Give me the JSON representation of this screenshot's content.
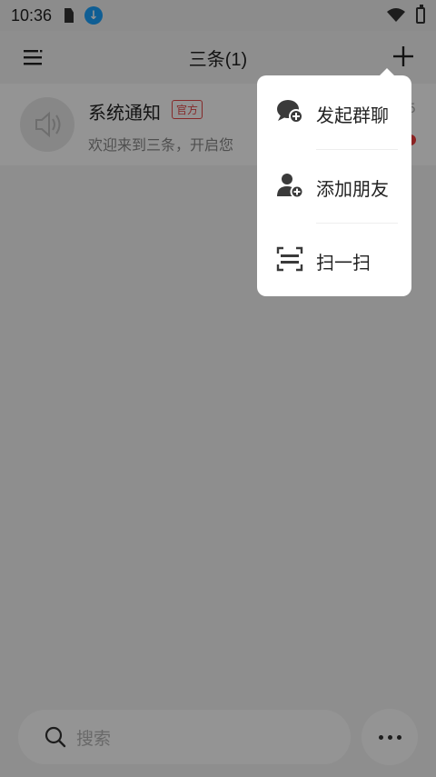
{
  "status_bar": {
    "time": "10:36",
    "icons": [
      "sim-icon",
      "download-icon",
      "wifi-icon",
      "battery-icon"
    ]
  },
  "header": {
    "title": "三条(1)",
    "left_icon": "menu-icon",
    "right_icon": "plus-icon"
  },
  "conversation": {
    "name": "系统通知",
    "badge": "官方",
    "message": "欢迎来到三条，开启您",
    "time_partial": "5",
    "avatar_icon": "speaker-icon"
  },
  "search": {
    "placeholder": "搜索"
  },
  "popup_menu": {
    "items": [
      {
        "label": "发起群聊",
        "icon": "group-chat-add-icon"
      },
      {
        "label": "添加朋友",
        "icon": "add-friend-icon"
      },
      {
        "label": "扫一扫",
        "icon": "scan-icon"
      }
    ]
  },
  "colors": {
    "badge_red": "#e54848",
    "unread_red": "#ef3b3b",
    "download_blue": "#1aa3ff",
    "overlay": "rgba(0,0,0,0.42)"
  }
}
